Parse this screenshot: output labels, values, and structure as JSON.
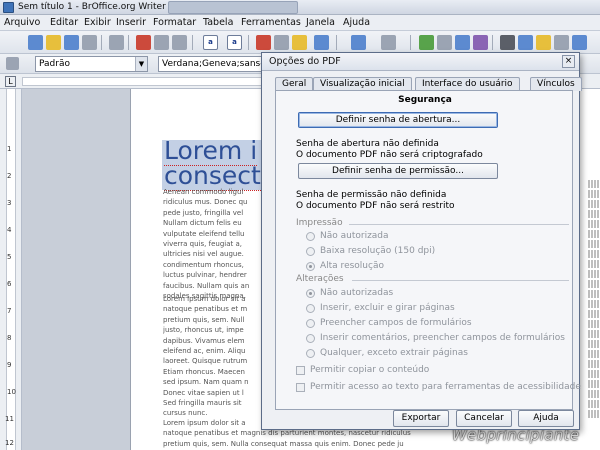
{
  "window": {
    "title": "Sem título 1 - BrOffice.org Writer"
  },
  "menu": [
    "Arquivo",
    "Editar",
    "Exibir",
    "Inserir",
    "Formatar",
    "Tabela",
    "Ferramentas",
    "Janela",
    "Ajuda"
  ],
  "formatting": {
    "style": "Padrão",
    "font": "Verdana;Geneva;sans-s"
  },
  "ruler_corner": "L",
  "vertical_ruler_numbers": [
    "1",
    "2",
    "3",
    "4",
    "5",
    "6",
    "7",
    "8",
    "9",
    "10",
    "11",
    "12"
  ],
  "document": {
    "heading_line1": "Lorem i",
    "heading_line2": "consect",
    "para1": [
      "Aenean commodo ligul",
      "ridiculus mus. Donec qu",
      "pede justo, fringilla vel",
      "Nullam dictum felis eu",
      "vulputate eleifend tellu",
      "viverra quis, feugiat a,",
      "ultricies nisi vel augue.",
      "condimentum rhoncus,",
      "luctus pulvinar, hendrer",
      "faucibus. Nullam quis an",
      "sodales sagittis magna."
    ],
    "para2": [
      "Lorem ipsum dolor sit a",
      "natoque penatibus et m",
      "pretium quis, sem. Null",
      "justo, rhoncus ut, impe",
      "dapibus. Vivamus elem",
      "eleifend ac, enim. Aliqu",
      "laoreet. Quisque rutrum",
      "Etiam rhoncus. Maecen",
      "sed ipsum. Nam quam n",
      "Donec vitae sapien ut l",
      "Sed fringilla mauris sit",
      "cursus nunc."
    ],
    "para3": [
      "Lorem ipsum dolor sit a",
      "natoque penatibus et magnis dis parturient montes, nascetur ridiculus",
      "pretium quis, sem. Nulla consequat massa quis enim. Donec pede ju"
    ]
  },
  "watermark": "Webprincipiante",
  "dialog": {
    "title": "Opções do PDF",
    "close": "×",
    "tabs": [
      "Geral",
      "Visualização inicial",
      "Interface do usuário",
      "Vínculos"
    ],
    "active_tab": "Segurança",
    "section_title": "Segurança",
    "open_password_button": "Definir senha de abertura...",
    "open_status_1": "Senha de abertura não definida",
    "open_status_2": "O documento PDF não será criptografado",
    "permission_password_button": "Definir senha de permissão...",
    "perm_status_1": "Senha de permissão não definida",
    "perm_status_2": "O documento PDF não será restrito",
    "printing_group": "Impressão",
    "printing_options": [
      "Não autorizada",
      "Baixa resolução (150 dpi)",
      "Alta resolução"
    ],
    "printing_selected": "Alta resolução",
    "changes_group": "Alterações",
    "changes_options": [
      "Não autorizadas",
      "Inserir, excluir e girar páginas",
      "Preencher campos de formulários",
      "Inserir comentários, preencher campos de formulários",
      "Qualquer, exceto extrair páginas"
    ],
    "changes_selected": "Não autorizadas",
    "check_copy": "Permitir copiar o conteúdo",
    "check_access": "Permitir acesso ao texto para ferramentas de acessibilidade",
    "export_button": "Exportar",
    "cancel_button": "Cancelar",
    "help_button": "Ajuda"
  }
}
